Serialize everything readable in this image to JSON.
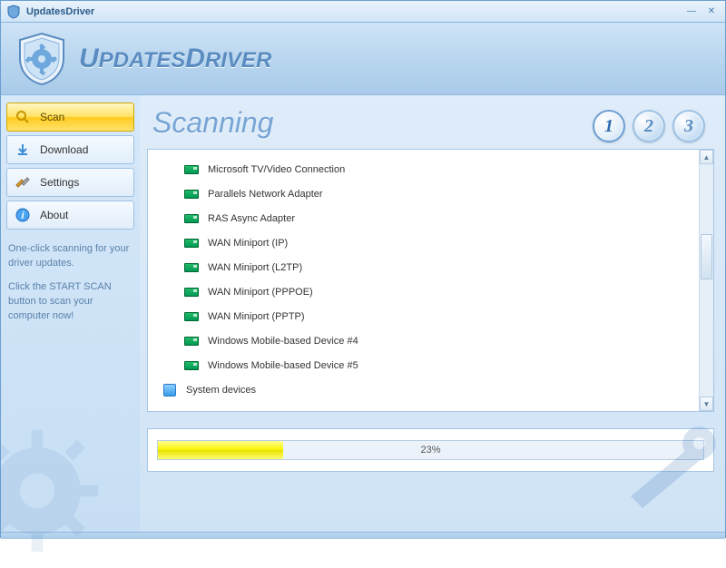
{
  "titlebar": {
    "text": "UpdatesDriver"
  },
  "header": {
    "logo_text": "UpdatesDriver"
  },
  "sidebar": {
    "items": [
      {
        "label": "Scan",
        "icon": "magnifier-icon",
        "active": true
      },
      {
        "label": "Download",
        "icon": "download-icon",
        "active": false
      },
      {
        "label": "Settings",
        "icon": "tools-icon",
        "active": false
      },
      {
        "label": "About",
        "icon": "info-icon",
        "active": false
      }
    ],
    "hint_line1": "One-click scanning for your driver updates.",
    "hint_line2": "Click the START SCAN button to scan your computer now!"
  },
  "content": {
    "title": "Scanning",
    "steps": [
      "1",
      "2",
      "3"
    ],
    "active_step": 1
  },
  "scan_list": [
    {
      "label": "Microsoft TV/Video Connection",
      "icon": "network-card-icon"
    },
    {
      "label": "Parallels Network Adapter",
      "icon": "network-card-icon"
    },
    {
      "label": "RAS Async Adapter",
      "icon": "network-card-icon"
    },
    {
      "label": "WAN Miniport (IP)",
      "icon": "network-card-icon"
    },
    {
      "label": "WAN Miniport (L2TP)",
      "icon": "network-card-icon"
    },
    {
      "label": "WAN Miniport (PPPOE)",
      "icon": "network-card-icon"
    },
    {
      "label": "WAN Miniport (PPTP)",
      "icon": "network-card-icon"
    },
    {
      "label": "Windows Mobile-based Device #4",
      "icon": "network-card-icon"
    },
    {
      "label": "Windows Mobile-based Device #5",
      "icon": "network-card-icon"
    }
  ],
  "scan_category": {
    "label": "System devices",
    "icon": "system-icon"
  },
  "progress": {
    "percent": 23,
    "label": "23%"
  }
}
